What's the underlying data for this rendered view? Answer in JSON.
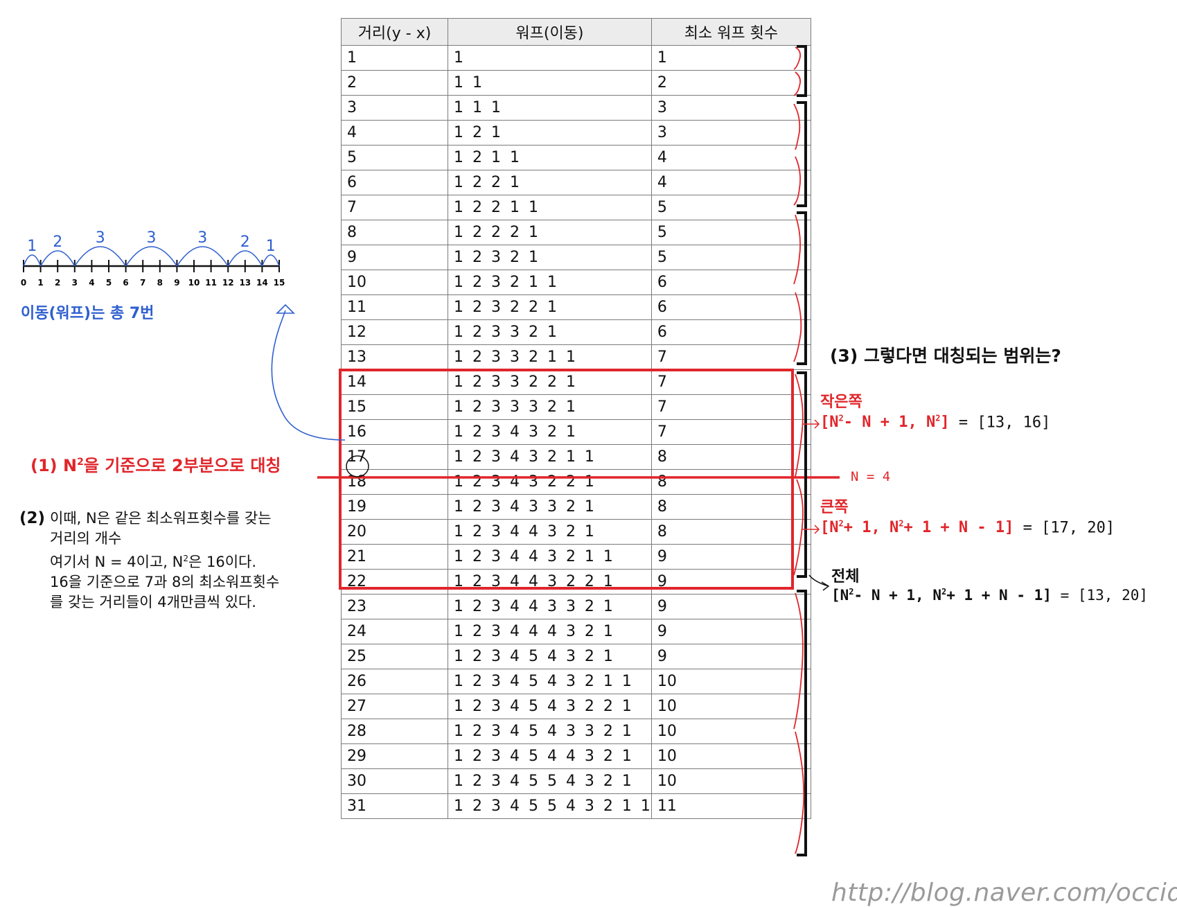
{
  "table": {
    "headers": [
      "거리(y - x)",
      "워프(이동)",
      "최소 워프 횟수"
    ],
    "rows": [
      [
        "1",
        "1",
        "1"
      ],
      [
        "2",
        "1 1",
        "2"
      ],
      [
        "3",
        "1 1 1",
        "3"
      ],
      [
        "4",
        "1 2 1",
        "3"
      ],
      [
        "5",
        "1 2 1 1",
        "4"
      ],
      [
        "6",
        "1 2 2 1",
        "4"
      ],
      [
        "7",
        "1 2 2 1 1",
        "5"
      ],
      [
        "8",
        "1 2 2 2 1",
        "5"
      ],
      [
        "9",
        "1 2 3 2 1",
        "5"
      ],
      [
        "10",
        "1 2 3 2 1 1",
        "6"
      ],
      [
        "11",
        "1 2 3 2 2 1",
        "6"
      ],
      [
        "12",
        "1 2 3 3 2 1",
        "6"
      ],
      [
        "13",
        "1 2 3 3 2 1 1",
        "7"
      ],
      [
        "14",
        "1 2 3 3 2 2 1",
        "7"
      ],
      [
        "15",
        "1 2 3 3 3 2 1",
        "7"
      ],
      [
        "16",
        "1 2 3 4 3 2 1",
        "7"
      ],
      [
        "17",
        "1 2 3 4 3 2 1 1",
        "8"
      ],
      [
        "18",
        "1 2 3 4 3 2 2 1",
        "8"
      ],
      [
        "19",
        "1 2 3 4 3 3 2 1",
        "8"
      ],
      [
        "20",
        "1 2 3 4 4 3 2 1",
        "8"
      ],
      [
        "21",
        "1 2 3 4 4 3 2 1 1",
        "9"
      ],
      [
        "22",
        "1 2 3 4 4 3 2 2 1",
        "9"
      ],
      [
        "23",
        "1 2 3 4 4 3 3 2 1",
        "9"
      ],
      [
        "24",
        "1 2 3 4 4 4 3 2 1",
        "9"
      ],
      [
        "25",
        "1 2 3 4 5 4 3 2 1",
        "9"
      ],
      [
        "26",
        "1 2 3 4 5 4 3 2 1 1",
        "10"
      ],
      [
        "27",
        "1 2 3 4 5 4 3 2 2 1",
        "10"
      ],
      [
        "28",
        "1 2 3 4 5 4 3 3 2 1",
        "10"
      ],
      [
        "29",
        "1 2 3 4 5 4 4 3 2 1",
        "10"
      ],
      [
        "30",
        "1 2 3 4 5 5 4 3 2 1",
        "10"
      ],
      [
        "31",
        "1 2 3 4 5 5 4 3 2 1 1",
        "11"
      ]
    ]
  },
  "number_line": {
    "ticks": [
      "0",
      "1",
      "2",
      "3",
      "4",
      "5",
      "6",
      "7",
      "8",
      "9",
      "10",
      "11",
      "12",
      "13",
      "14",
      "15"
    ],
    "hop_labels": [
      "1",
      "2",
      "3",
      "3",
      "3",
      "2",
      "1"
    ],
    "caption": "이동(워프)는 총 7번"
  },
  "note1": {
    "prefix": "(1) N",
    "sup": "2",
    "suffix": "을 기준으로 2부분으로 대칭"
  },
  "note2": {
    "label": "(2)",
    "line1": "이때, N은 같은 최소워프횟수를 갖는",
    "line2": "거리의 개수",
    "line3_a": "여기서 N = 4이고, N",
    "line3_sup": "2",
    "line3_b": "은 16이다.",
    "line4": "16을 기준으로 7과 8의 최소워프횟수",
    "line5": "를 갖는 거리들이 4개만큼씩 있다."
  },
  "note3": {
    "question": "(3) 그렇다면 대칭되는 범위는?",
    "small_label": "작은쪽",
    "small_a": "[N",
    "small_sup1": "2",
    "small_b": "- N + 1, N",
    "small_sup2": "2",
    "small_c": "]",
    "small_result": "= [13, 16]",
    "n_label": "N = 4",
    "big_label": "큰쪽",
    "big_a": "[N",
    "big_sup1": "2",
    "big_b": "+ 1, N",
    "big_sup2": "2",
    "big_c": "+ 1 + N - 1]",
    "big_result": "= [17, 20]",
    "total_label": "전체",
    "total_a": "[N",
    "total_sup1": "2",
    "total_b": "- N + 1, N",
    "total_sup2": "2",
    "total_c": "+ 1 + N - 1]",
    "total_result": "= [13, 20]"
  },
  "watermark": "http://blog.naver.com/occidere",
  "colors": {
    "red": "#e0262b",
    "blue": "#2e5fcf",
    "black": "#111111",
    "header_bg": "#ececec"
  }
}
